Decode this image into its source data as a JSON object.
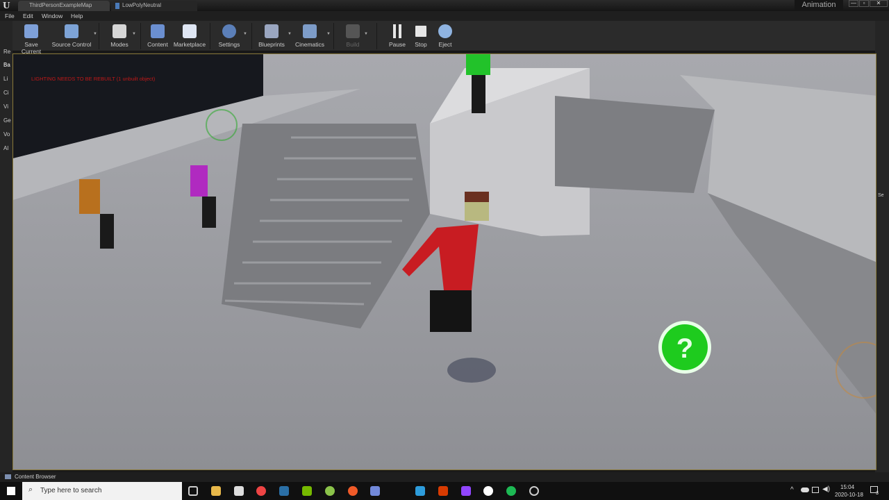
{
  "window": {
    "tabs": [
      "ThirdPersonExampleMap",
      "LowPolyNeutral"
    ],
    "layout_label": "Animation",
    "controls": [
      "—",
      "▫",
      "✕"
    ]
  },
  "menu": [
    "File",
    "Edit",
    "Window",
    "Help"
  ],
  "toolbar": {
    "buttons": [
      {
        "label": "Save Current",
        "color": "#7ea0d8"
      },
      {
        "label": "Source Control",
        "color": "#7da3d6"
      },
      {
        "label": "Modes",
        "color": "#d6d6d6"
      },
      {
        "label": "Content",
        "color": "#6b8fd0"
      },
      {
        "label": "Marketplace",
        "color": "#dfe6f3"
      },
      {
        "label": "Settings",
        "color": "#5b7fb8"
      },
      {
        "label": "Blueprints",
        "color": "#9aa6c0"
      },
      {
        "label": "Cinematics",
        "color": "#7d9cc8"
      },
      {
        "label": "Build",
        "color": "#555555"
      },
      {
        "label": "Pause",
        "color": "#e6e6e6"
      },
      {
        "label": "Stop",
        "color": "#e6e6e6"
      },
      {
        "label": "Eject",
        "color": "#8fb3e0"
      }
    ]
  },
  "left_panel": [
    "Re",
    "Ba",
    "Li",
    "Ci",
    "Vi",
    "Ge",
    "Vo",
    "Al"
  ],
  "right_panel": [
    "Se"
  ],
  "viewport": {
    "warning": "LIGHTING NEEDS TO BE REBUILT (1 unbuilt object)"
  },
  "bottom": {
    "content_browser": "Content Browser"
  },
  "taskbar": {
    "search_placeholder": "Type here to search",
    "time": "15:04",
    "date": "2020-10-18",
    "notifications": "3"
  }
}
